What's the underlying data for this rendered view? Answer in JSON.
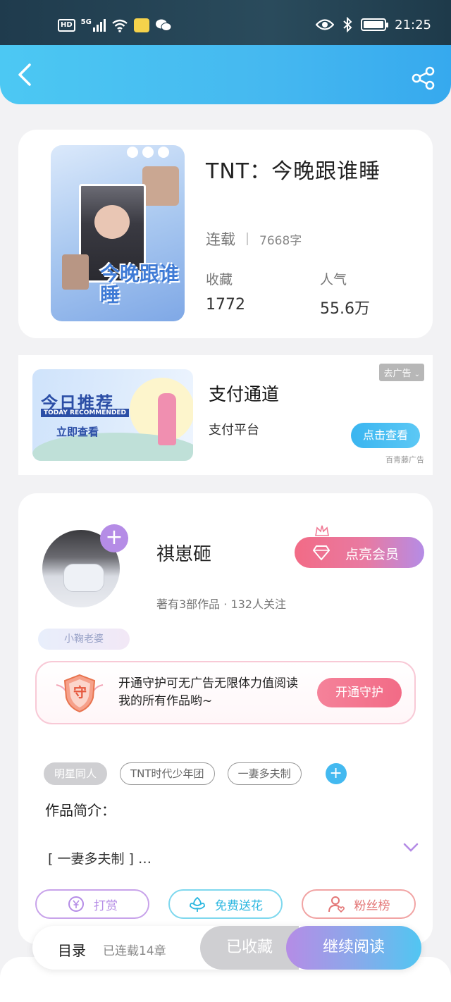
{
  "status_bar": {
    "hd_badge": "HD",
    "network": "5G",
    "time": "21:25",
    "icons": [
      "signal-icon",
      "wifi-icon",
      "notification-app-icon",
      "wechat-icon",
      "eye-icon",
      "bluetooth-icon",
      "battery-icon"
    ]
  },
  "header": {
    "back_icon": "back-icon",
    "share_icon": "share-icon"
  },
  "book": {
    "title": "TNT：今晚跟谁睡",
    "cover_text": "今晚跟谁睡",
    "status": "连载",
    "word_count": "7668字",
    "favorites_label": "收藏",
    "favorites_value": "1772",
    "popularity_label": "人气",
    "popularity_value": "55.6万"
  },
  "ad": {
    "image_title": "今日推荐",
    "image_subtitle": "TODAY RECOMMENDED",
    "image_cta": "立即查看",
    "title": "支付通道",
    "subtitle": "支付平台",
    "remove_label": "去广告",
    "button_label": "点击查看",
    "source": "百青藤广告"
  },
  "author": {
    "name": "祺崽砸",
    "meta": "著有3部作品 · 132人关注",
    "vip_button": "点亮会员",
    "badge": "小鞠老婆",
    "guard_icon_text": "守",
    "guard_text": "开通守护可无广告无限体力值阅读我的所有作品哟~",
    "guard_button": "开通守护"
  },
  "tags": [
    "明星同人",
    "TNT时代少年团",
    "一妻多夫制"
  ],
  "intro": {
    "label": "作品简介：",
    "text": "[ 一妻多夫制 ] …"
  },
  "actions": {
    "reward": "打赏",
    "flower": "免费送花",
    "fans": "粉丝榜"
  },
  "bottom": {
    "toc": "目录",
    "chapters": "已连载14章",
    "collected": "已收藏",
    "continue": "继续阅读"
  },
  "colors": {
    "header_blue": "#45b8f0",
    "accent_purple": "#b58ce6",
    "accent_pink": "#f26b86",
    "accent_cyan": "#51c6f2"
  }
}
